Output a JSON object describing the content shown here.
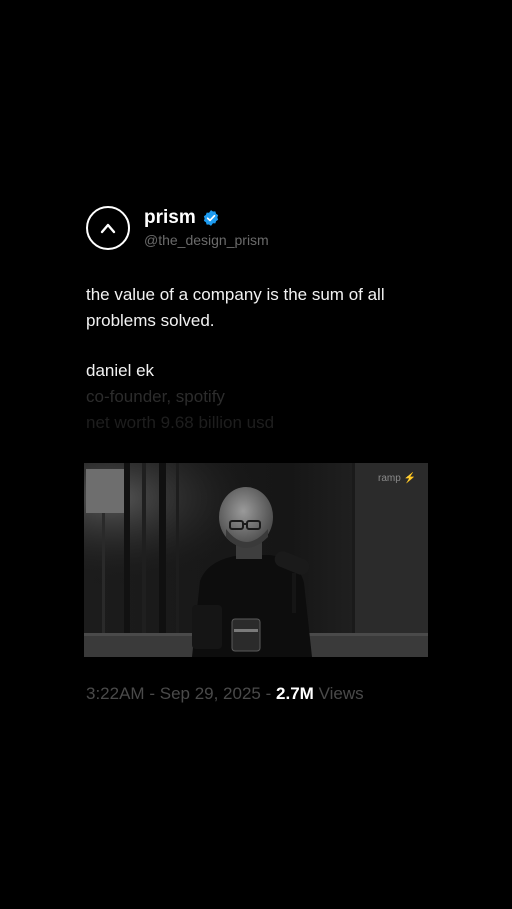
{
  "post": {
    "author_name": "prism",
    "author_handle": "@the_design_prism",
    "verified": true,
    "quote_line1": "the value of a company is the sum of all",
    "quote_line2": "problems solved.",
    "attribution_name": "daniel ek",
    "attribution_role": "co-founder, spotify",
    "attribution_detail": "net worth 9.68 billion usd",
    "media_watermark": "ramp ⚡",
    "time": "3:22AM",
    "separator": "-",
    "date": "Sep 29, 2025",
    "views_count": "2.7M",
    "views_label": "Views"
  },
  "icons": {
    "avatar": "caret-up-logo-icon",
    "verified": "verified-badge-icon"
  },
  "colors": {
    "background": "#000000",
    "text_primary": "#ffffff",
    "text_muted": "#6b6b6b",
    "verified_blue": "#1d9bf0"
  }
}
